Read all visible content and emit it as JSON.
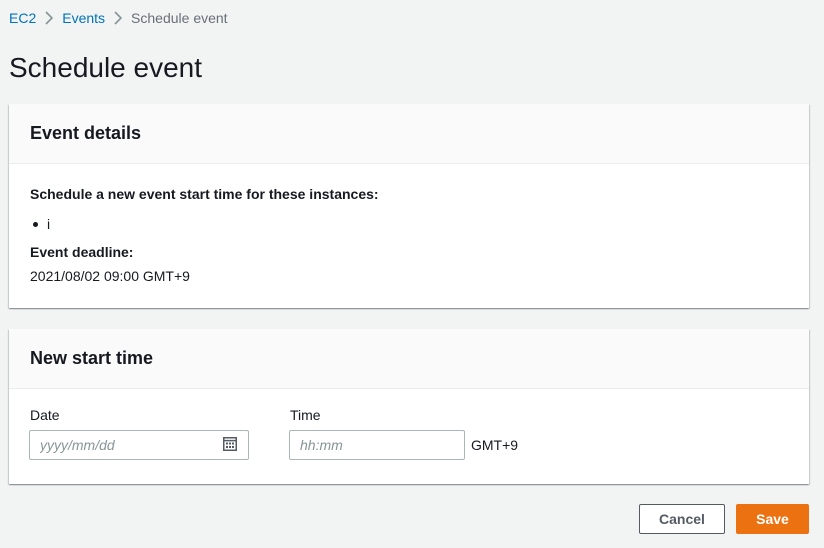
{
  "breadcrumb": {
    "items": [
      {
        "label": "EC2"
      },
      {
        "label": "Events"
      }
    ],
    "current": "Schedule event"
  },
  "page_title": "Schedule event",
  "event_details": {
    "header": "Event details",
    "instances_label": "Schedule a new event start time for these instances:",
    "instances": [
      "i"
    ],
    "deadline_label": "Event deadline:",
    "deadline_value": "2021/08/02 09:00 GMT+9"
  },
  "new_start_time": {
    "header": "New start time",
    "date_label": "Date",
    "date_placeholder": "yyyy/mm/dd",
    "date_value": "",
    "time_label": "Time",
    "time_placeholder": "hh:mm",
    "time_value": "",
    "timezone": "GMT+9"
  },
  "actions": {
    "cancel_label": "Cancel",
    "save_label": "Save"
  },
  "colors": {
    "link": "#0073bb",
    "primary": "#ec7211",
    "background": "#f2f3f3",
    "text": "#16191f"
  },
  "icons": {
    "breadcrumb_separator": "chevron-right-icon",
    "date_picker": "calendar-icon"
  }
}
